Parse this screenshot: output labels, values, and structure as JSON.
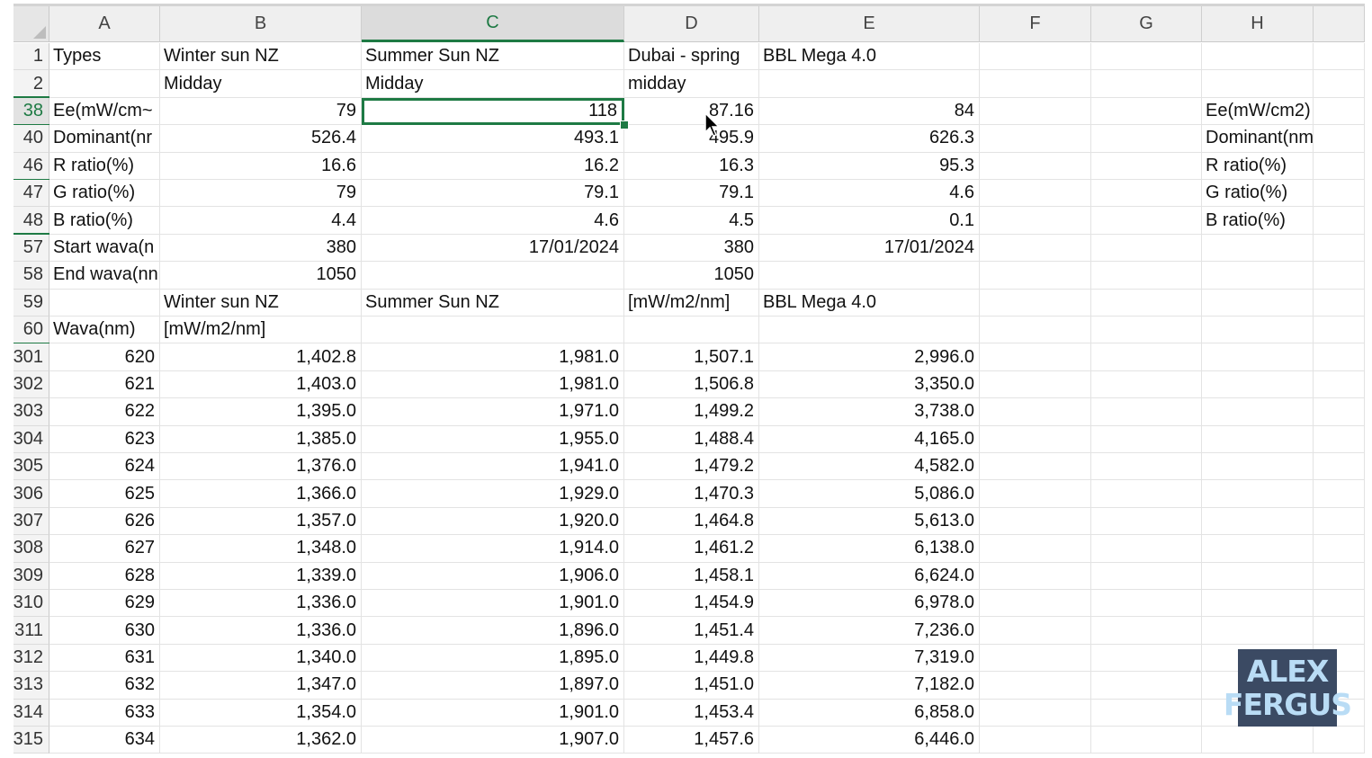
{
  "columns": [
    "A",
    "B",
    "C",
    "D",
    "E",
    "F",
    "G",
    "H"
  ],
  "selected_column": "C",
  "selected_row": "38",
  "rows": [
    {
      "num": "1",
      "cells": [
        "Types",
        "Winter sun NZ",
        "Summer Sun NZ",
        "Dubai - spring",
        "BBL Mega 4.0",
        "",
        "",
        ""
      ]
    },
    {
      "num": "2",
      "cells": [
        "",
        "Midday",
        "Midday",
        "midday",
        "",
        "",
        "",
        ""
      ]
    },
    {
      "num": "38",
      "cells": [
        "Ee(mW/cm~",
        "79",
        "118",
        "87.16",
        "84",
        "",
        "",
        "Ee(mW/cm2)"
      ]
    },
    {
      "num": "40",
      "cells": [
        "Dominant(nr",
        "526.4",
        "493.1",
        "495.9",
        "626.3",
        "",
        "",
        "Dominant(nm)"
      ]
    },
    {
      "num": "46",
      "cells": [
        "R ratio(%)",
        "16.6",
        "16.2",
        "16.3",
        "95.3",
        "",
        "",
        "R ratio(%)"
      ]
    },
    {
      "num": "47",
      "cells": [
        "G ratio(%)",
        "79",
        "79.1",
        "79.1",
        "4.6",
        "",
        "",
        "G ratio(%)"
      ]
    },
    {
      "num": "48",
      "cells": [
        "B ratio(%)",
        "4.4",
        "4.6",
        "4.5",
        "0.1",
        "",
        "",
        "B ratio(%)"
      ]
    },
    {
      "num": "57",
      "cells": [
        "Start wava(n",
        "380",
        "17/01/2024",
        "380",
        "17/01/2024",
        "",
        "",
        ""
      ]
    },
    {
      "num": "58",
      "cells": [
        "End wava(nn",
        "1050",
        "",
        "1050",
        "",
        "",
        "",
        ""
      ]
    },
    {
      "num": "59",
      "cells": [
        "",
        "Winter sun NZ",
        "Summer Sun NZ",
        "[mW/m2/nm]",
        "BBL Mega 4.0",
        "",
        "",
        ""
      ]
    },
    {
      "num": "60",
      "cells": [
        "Wava(nm)",
        "[mW/m2/nm]",
        "",
        "",
        "",
        "",
        "",
        ""
      ]
    },
    {
      "num": "301",
      "cells": [
        "620",
        "1,402.8",
        "1,981.0",
        "1,507.1",
        "2,996.0",
        "",
        "",
        ""
      ]
    },
    {
      "num": "302",
      "cells": [
        "621",
        "1,403.0",
        "1,981.0",
        "1,506.8",
        "3,350.0",
        "",
        "",
        ""
      ]
    },
    {
      "num": "303",
      "cells": [
        "622",
        "1,395.0",
        "1,971.0",
        "1,499.2",
        "3,738.0",
        "",
        "",
        ""
      ]
    },
    {
      "num": "304",
      "cells": [
        "623",
        "1,385.0",
        "1,955.0",
        "1,488.4",
        "4,165.0",
        "",
        "",
        ""
      ]
    },
    {
      "num": "305",
      "cells": [
        "624",
        "1,376.0",
        "1,941.0",
        "1,479.2",
        "4,582.0",
        "",
        "",
        ""
      ]
    },
    {
      "num": "306",
      "cells": [
        "625",
        "1,366.0",
        "1,929.0",
        "1,470.3",
        "5,086.0",
        "",
        "",
        ""
      ]
    },
    {
      "num": "307",
      "cells": [
        "626",
        "1,357.0",
        "1,920.0",
        "1,464.8",
        "5,613.0",
        "",
        "",
        ""
      ]
    },
    {
      "num": "308",
      "cells": [
        "627",
        "1,348.0",
        "1,914.0",
        "1,461.2",
        "6,138.0",
        "",
        "",
        ""
      ]
    },
    {
      "num": "309",
      "cells": [
        "628",
        "1,339.0",
        "1,906.0",
        "1,458.1",
        "6,624.0",
        "",
        "",
        ""
      ]
    },
    {
      "num": "310",
      "cells": [
        "629",
        "1,336.0",
        "1,901.0",
        "1,454.9",
        "6,978.0",
        "",
        "",
        ""
      ]
    },
    {
      "num": "311",
      "cells": [
        "630",
        "1,336.0",
        "1,896.0",
        "1,451.4",
        "7,236.0",
        "",
        "",
        ""
      ]
    },
    {
      "num": "312",
      "cells": [
        "631",
        "1,340.0",
        "1,895.0",
        "1,449.8",
        "7,319.0",
        "",
        "",
        ""
      ]
    },
    {
      "num": "313",
      "cells": [
        "632",
        "1,347.0",
        "1,897.0",
        "1,451.0",
        "7,182.0",
        "",
        "",
        ""
      ]
    },
    {
      "num": "314",
      "cells": [
        "633",
        "1,354.0",
        "1,901.0",
        "1,453.4",
        "6,858.0",
        "",
        "",
        ""
      ]
    },
    {
      "num": "315",
      "cells": [
        "634",
        "1,362.0",
        "1,907.0",
        "1,457.6",
        "6,446.0",
        "",
        "",
        ""
      ]
    }
  ],
  "logo": {
    "line1": "ALEX",
    "line2": "FERGUS"
  },
  "colors": {
    "selection": "#1e7a44",
    "header_bg": "#efefef",
    "logo_bg": "#3b4a63",
    "logo_text": "#b9dcf5"
  }
}
